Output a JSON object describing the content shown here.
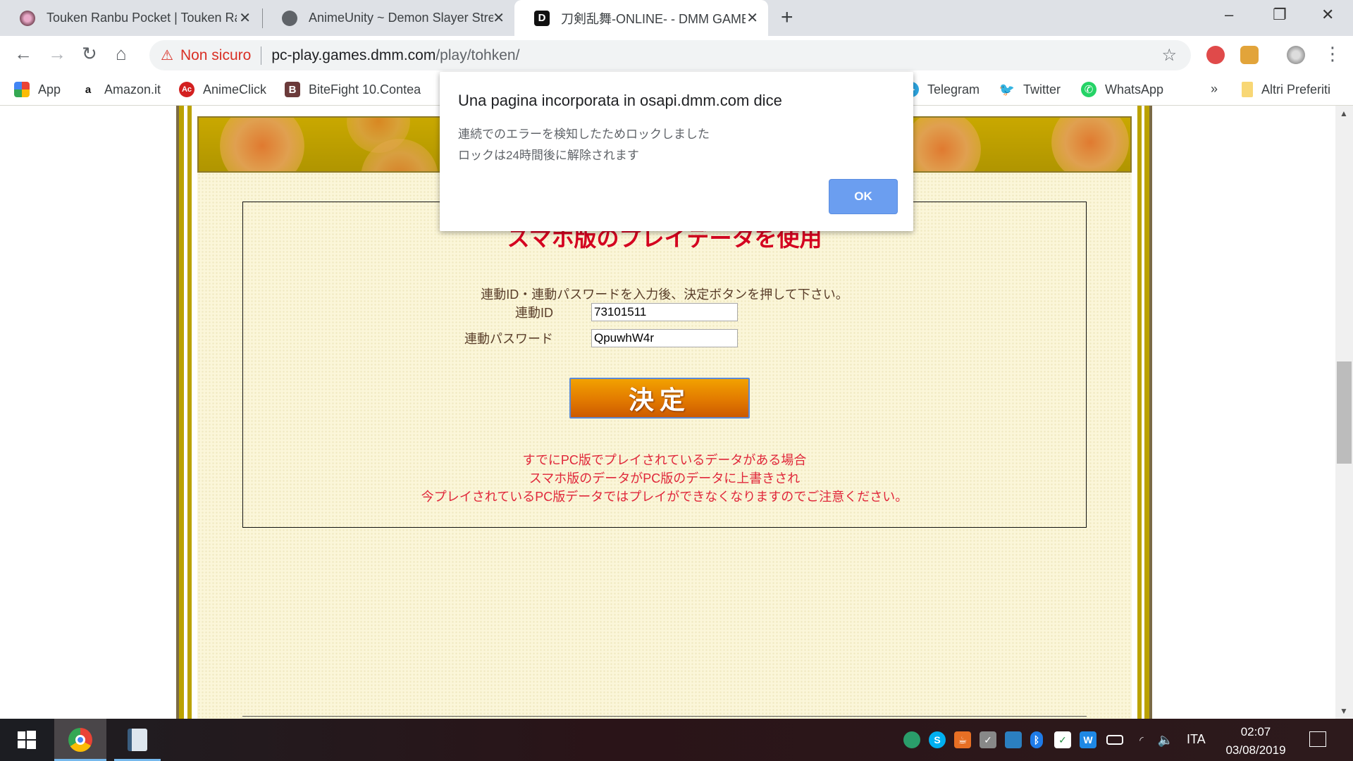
{
  "browser": {
    "tabs": [
      {
        "title": "Touken Ranbu Pocket | Touken Ranbu",
        "icon": "touken-pocket-favicon",
        "active": false
      },
      {
        "title": "AnimeUnity ~ Demon Slayer Streaming",
        "icon": "globe-icon",
        "active": false
      },
      {
        "title": "刀剣乱舞-ONLINE- - DMM GAMES",
        "icon": "dmm-d-icon",
        "active": true
      }
    ],
    "new_tab_label": "+",
    "window_controls": {
      "minimize": "–",
      "maximize": "❐",
      "close": "✕"
    },
    "toolbar": {
      "back": "←",
      "forward": "→",
      "reload": "↻",
      "home": "⌂",
      "security_icon": "⚠",
      "security_label": "Non sicuro",
      "url_host": "pc-play.games.dmm.com",
      "url_path": "/play/tohken/",
      "star": "☆",
      "menu": "⋮"
    },
    "bookmarks": [
      {
        "label": "App",
        "icon": "apps-grid-icon"
      },
      {
        "label": "Amazon.it",
        "icon": "amazon-icon"
      },
      {
        "label": "AnimeClick",
        "icon": "animeclick-icon"
      },
      {
        "label": "BiteFight 10.Contea",
        "icon": "bitefight-icon"
      },
      {
        "label": "Telegram",
        "icon": "telegram-icon"
      },
      {
        "label": "Twitter",
        "icon": "twitter-icon"
      },
      {
        "label": "WhatsApp",
        "icon": "whatsapp-icon"
      }
    ],
    "bookmarks_overflow": "»",
    "other_bookmarks": "Altri Preferiti"
  },
  "page": {
    "heading": "スマホ版のプレイデータを使用",
    "instructions": "連動ID・連動パスワードを入力後、決定ボタンを押して下さい。",
    "fields": [
      {
        "label": "連動ID",
        "value": "73101511"
      },
      {
        "label": "連動パスワード",
        "value": "QpuwhW4r"
      }
    ],
    "submit_label": "決定",
    "warning_lines": [
      "すでにPC版でプレイされているデータがある場合",
      "スマホ版のデータがPC版のデータに上書きされ",
      "今プレイされているPC版データではプレイができなくなりますのでご注意ください。"
    ],
    "colors": {
      "heading": "#d4001f",
      "warning": "#e0273a",
      "background": "#fbf6d9",
      "gold": "#b9a000"
    }
  },
  "dialog": {
    "title": "Una pagina incorporata in osapi.dmm.com dice",
    "messages": [
      "連続でのエラーを検知したためロックしました",
      "ロックは24時間後に解除されます"
    ],
    "ok_label": "OK"
  },
  "scrollbar": {
    "up": "▲",
    "down": "▼"
  },
  "taskbar": {
    "start_icon": "windows-logo-icon",
    "apps": [
      "chrome-icon",
      "notes-app-icon"
    ],
    "tray_icons": [
      "app-tray-icon",
      "skype-icon",
      "java-icon",
      "printer-check-icon",
      "intel-graphics-icon",
      "bluetooth-icon",
      "defender-icon",
      "waves-audio-icon",
      "battery-icon",
      "wifi-icon",
      "volume-icon"
    ],
    "language": "ITA",
    "time": "02:07",
    "date": "03/08/2019"
  }
}
